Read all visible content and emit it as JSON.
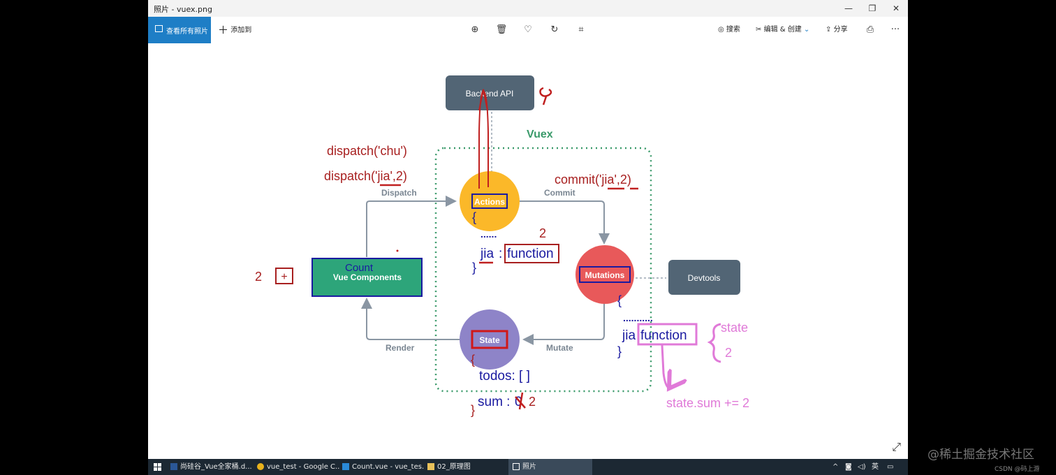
{
  "window": {
    "title": "照片 - vuex.png",
    "min": "—",
    "max": "❐",
    "close": "✕"
  },
  "toolbar": {
    "view_all": "查看所有照片",
    "add_to": "添加到",
    "search": "搜索",
    "edit_create": "编辑 & 创建",
    "share": "分享",
    "more": "···"
  },
  "diagram": {
    "backend": "Backend API",
    "vuex": "Vuex",
    "dispatch": "Dispatch",
    "commit": "Commit",
    "mutate": "Mutate",
    "render": "Render",
    "actions": "Actions",
    "mutations": "Mutations",
    "state": "State",
    "devtools": "Devtools",
    "vue_components": "Vue Components",
    "count": "Count",
    "ann_dispatch_chu": "dispatch('chu')",
    "ann_dispatch_jia": "dispatch('jia',2)",
    "ann_commit_jia": "commit('jia',2)",
    "ann_two_a": "2",
    "ann_two_b": "2",
    "ann_plus": "+",
    "ann_brace_open_a": "{",
    "ann_dots_a": "......",
    "ann_jia": "jia",
    "ann_colon": ":",
    "ann_function_a": "function",
    "ann_brace_close_a": "}",
    "ann_brace_open_b": "{",
    "ann_dots_b": "...........",
    "ann_jia_function": "jia",
    "ann_function_b": "function",
    "ann_brace_close_b": "}",
    "ann_state": "state",
    "ann_two_c": "2",
    "ann_state_sum": "state.sum += 2",
    "ann_brace_open_c": "{",
    "ann_todos": "todos: [ ]",
    "ann_sum": "sum :",
    "ann_sum_zero": "0",
    "ann_sum_two": "2",
    "ann_brace_close_c": "}"
  },
  "taskbar": {
    "items": [
      "尚硅谷_Vue全家桶.d...",
      "vue_test - Google C...",
      "Count.vue - vue_tes...",
      "02_原理图",
      "照片"
    ],
    "ime": "英"
  },
  "watermark": "@稀土掘金技术社区",
  "csdn": "CSDN @码上游",
  "colors": {
    "accent": "#1e7ec6",
    "vuex_green": "#3a9a6a",
    "ink_red": "#b02020",
    "ink_blue": "#1a1aa0",
    "ink_pink": "#e07ad8"
  }
}
